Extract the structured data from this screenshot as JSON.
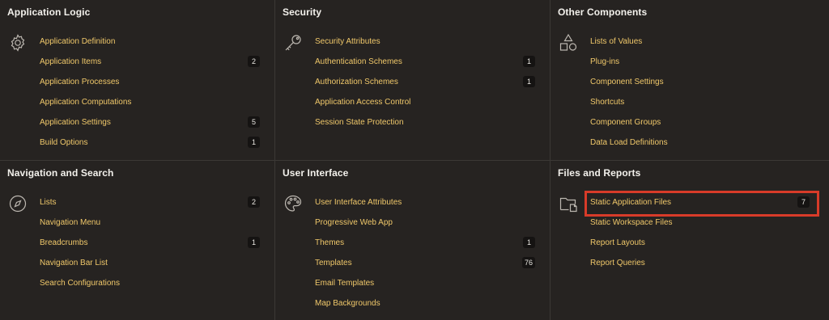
{
  "panels": [
    {
      "title": "Application Logic",
      "icon": "gear-icon",
      "items": [
        {
          "label": "Application Definition",
          "badge": ""
        },
        {
          "label": "Application Items",
          "badge": "2"
        },
        {
          "label": "Application Processes",
          "badge": ""
        },
        {
          "label": "Application Computations",
          "badge": ""
        },
        {
          "label": "Application Settings",
          "badge": "5"
        },
        {
          "label": "Build Options",
          "badge": "1"
        }
      ]
    },
    {
      "title": "Security",
      "icon": "key-icon",
      "items": [
        {
          "label": "Security Attributes",
          "badge": ""
        },
        {
          "label": "Authentication Schemes",
          "badge": "1"
        },
        {
          "label": "Authorization Schemes",
          "badge": "1"
        },
        {
          "label": "Application Access Control",
          "badge": ""
        },
        {
          "label": "Session State Protection",
          "badge": ""
        }
      ]
    },
    {
      "title": "Other Components",
      "icon": "shapes-icon",
      "items": [
        {
          "label": "Lists of Values",
          "badge": ""
        },
        {
          "label": "Plug-ins",
          "badge": ""
        },
        {
          "label": "Component Settings",
          "badge": ""
        },
        {
          "label": "Shortcuts",
          "badge": ""
        },
        {
          "label": "Component Groups",
          "badge": ""
        },
        {
          "label": "Data Load Definitions",
          "badge": ""
        }
      ]
    },
    {
      "title": "Navigation and Search",
      "icon": "compass-icon",
      "items": [
        {
          "label": "Lists",
          "badge": "2"
        },
        {
          "label": "Navigation Menu",
          "badge": ""
        },
        {
          "label": "Breadcrumbs",
          "badge": "1"
        },
        {
          "label": "Navigation Bar List",
          "badge": ""
        },
        {
          "label": "Search Configurations",
          "badge": ""
        }
      ]
    },
    {
      "title": "User Interface",
      "icon": "palette-icon",
      "items": [
        {
          "label": "User Interface Attributes",
          "badge": ""
        },
        {
          "label": "Progressive Web App",
          "badge": ""
        },
        {
          "label": "Themes",
          "badge": "1"
        },
        {
          "label": "Templates",
          "badge": "76"
        },
        {
          "label": "Email Templates",
          "badge": ""
        },
        {
          "label": "Map Backgrounds",
          "badge": ""
        }
      ]
    },
    {
      "title": "Files and Reports",
      "icon": "folder-file-icon",
      "items": [
        {
          "label": "Static Application Files",
          "badge": "7"
        },
        {
          "label": "Static Workspace Files",
          "badge": ""
        },
        {
          "label": "Report Layouts",
          "badge": ""
        },
        {
          "label": "Report Queries",
          "badge": ""
        }
      ]
    }
  ],
  "highlight": {
    "panel": 5,
    "item": 0,
    "color": "#d83b29"
  }
}
